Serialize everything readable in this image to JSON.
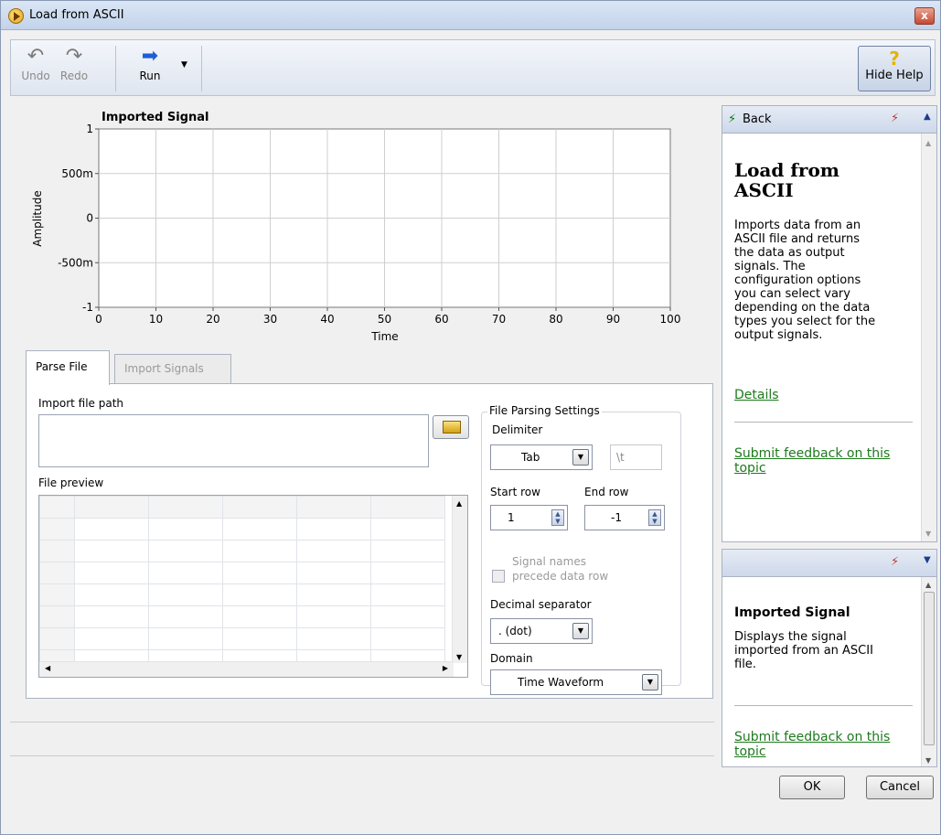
{
  "window": {
    "title": "Load from ASCII",
    "close_label": "x"
  },
  "toolbar": {
    "undo_label": "Undo",
    "redo_label": "Redo",
    "run_label": "Run",
    "hide_help_label": "Hide Help"
  },
  "chart_data": {
    "type": "line",
    "title": "Imported Signal",
    "xlabel": "Time",
    "ylabel": "Amplitude",
    "xlim": [
      0,
      100
    ],
    "ylim": [
      -1,
      1
    ],
    "x_ticks": [
      "0",
      "10",
      "20",
      "30",
      "40",
      "50",
      "60",
      "70",
      "80",
      "90",
      "100"
    ],
    "y_ticks": [
      "1",
      "500m",
      "0",
      "-500m",
      "-1"
    ],
    "grid": true,
    "series": []
  },
  "tabs": [
    {
      "label": "Parse File",
      "active": true
    },
    {
      "label": "Import Signals",
      "active": false
    }
  ],
  "parse": {
    "import_path_label": "Import file path",
    "import_path_value": "",
    "file_preview_label": "File preview",
    "settings_title": "File Parsing Settings",
    "delimiter_label": "Delimiter",
    "delimiter_value": "Tab",
    "delimiter_escape": "\\t",
    "start_row_label": "Start row",
    "start_row_value": "1",
    "end_row_label": "End row",
    "end_row_value": "-1",
    "signal_names_label_1": "Signal names",
    "signal_names_label_2": "precede data row",
    "decimal_label": "Decimal separator",
    "decimal_value": ". (dot)",
    "domain_label": "Domain",
    "domain_value": "Time Waveform"
  },
  "help": {
    "back_label": "Back",
    "title_1": "Load from",
    "title_2": "ASCII",
    "desc_lines": [
      "Imports data from an",
      "ASCII file and returns",
      "the data as output",
      "signals. The",
      "configuration options",
      "you can select vary",
      "depending on the data",
      "types you select for the",
      "output signals."
    ],
    "details_link": "Details",
    "feedback_1": "Submit feedback on this",
    "feedback_2": "topic",
    "sub_title": "Imported Signal",
    "sub_desc_lines": [
      "Displays the signal",
      "imported from an ASCII",
      "file."
    ],
    "sub_feedback_1": "Submit feedback on this",
    "sub_feedback_2": "topic"
  },
  "buttons": {
    "ok": "OK",
    "cancel": "Cancel"
  }
}
